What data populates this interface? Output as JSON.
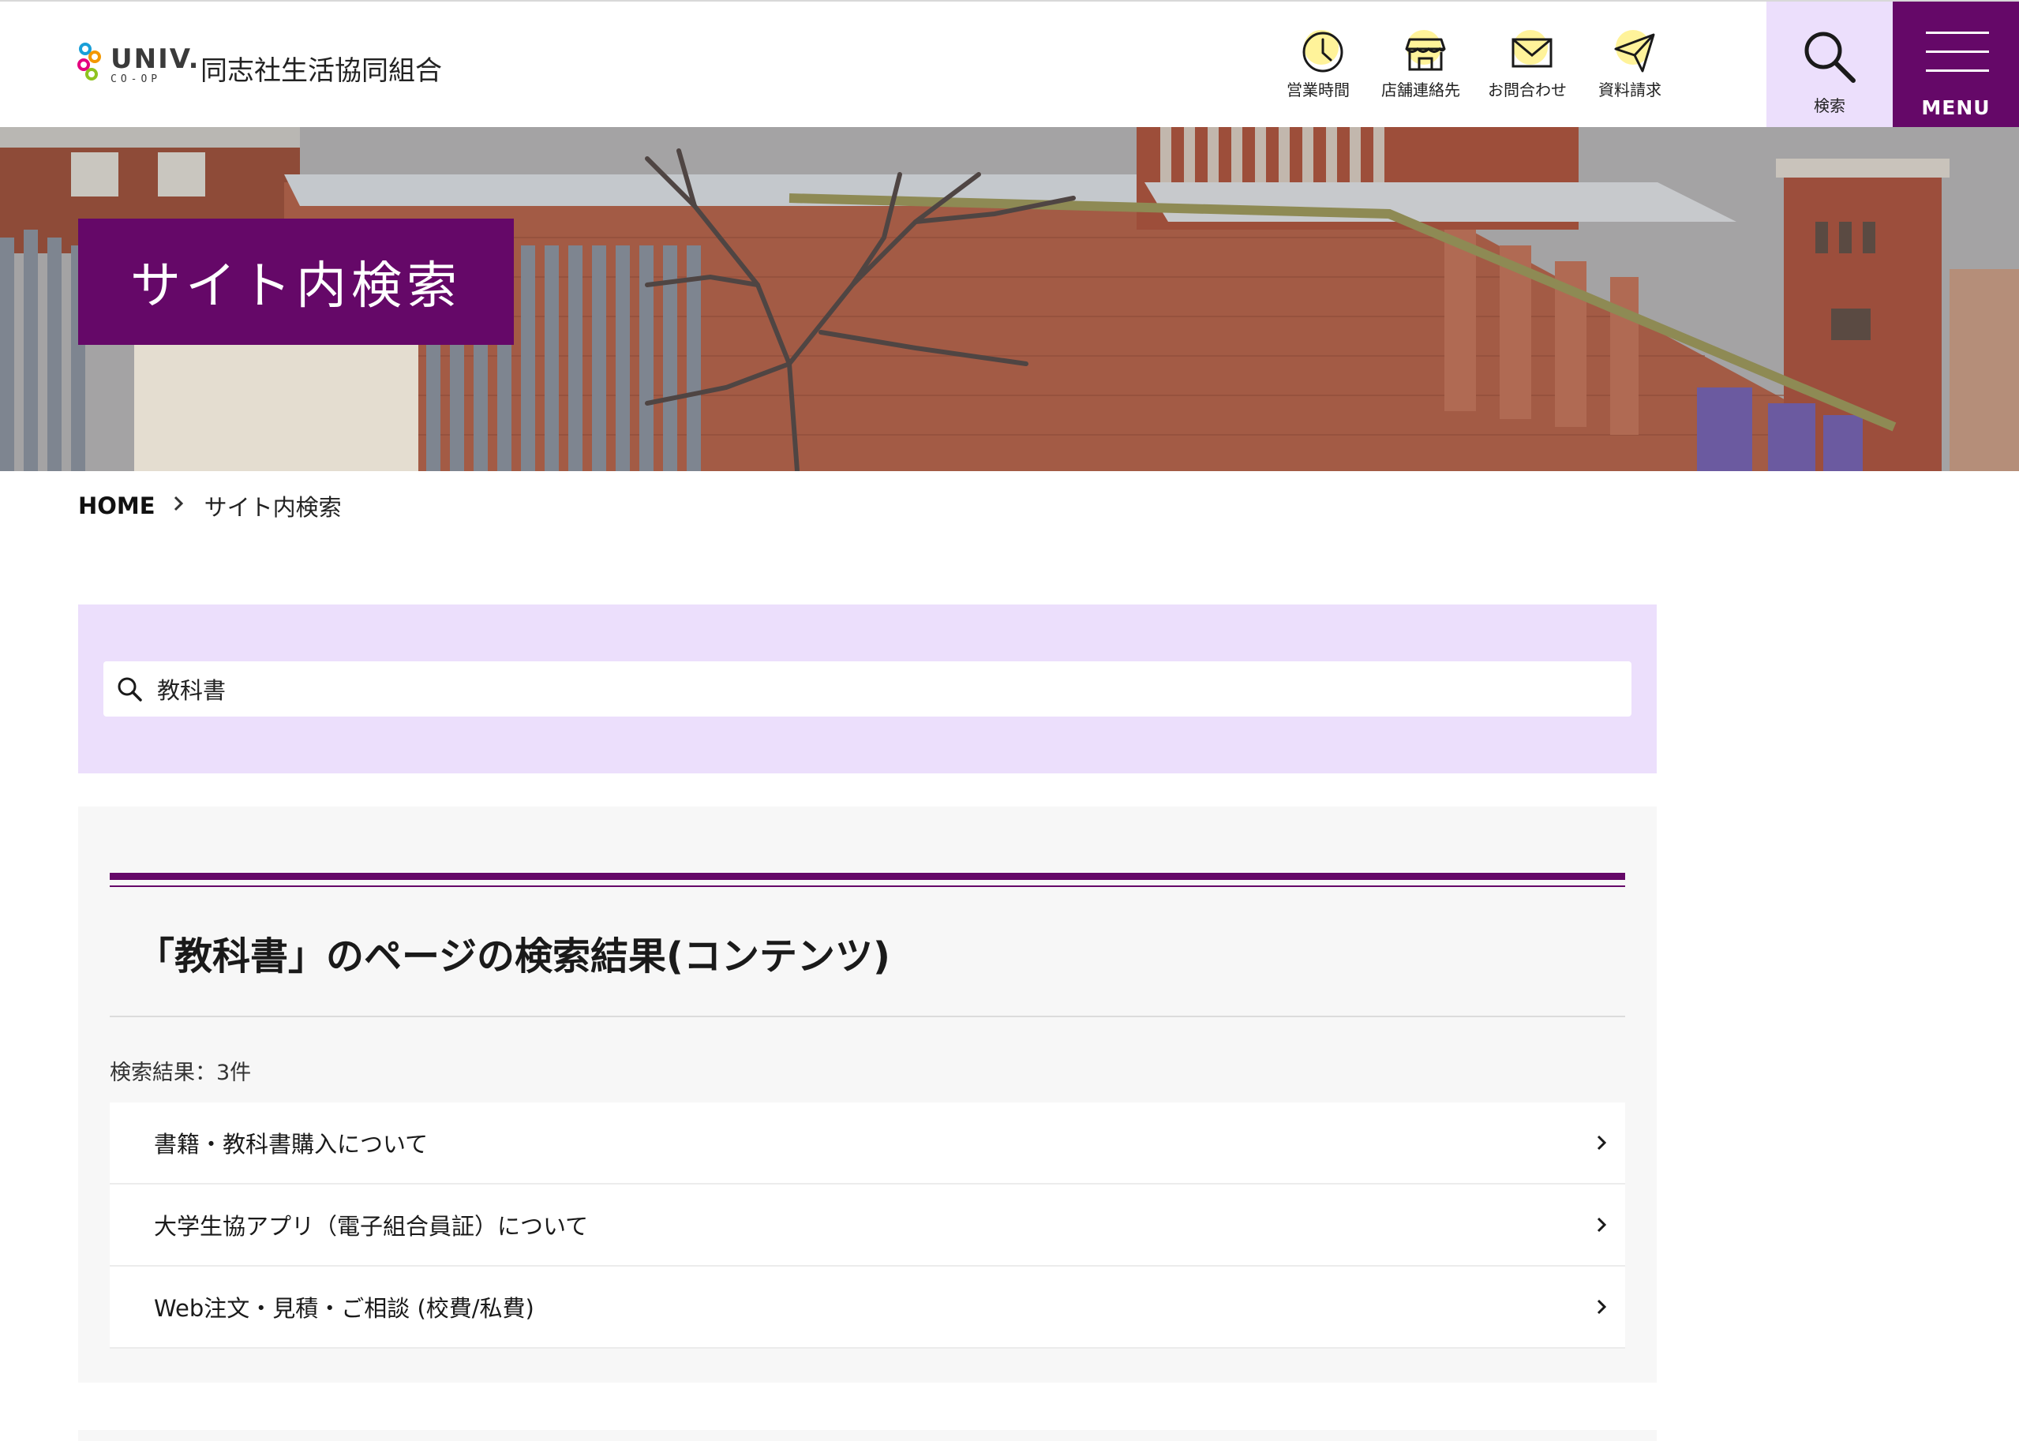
{
  "header": {
    "logo_univ": "UNIV.",
    "logo_coop": "CO-OP",
    "org_name": "同志社生活協同組合",
    "links": [
      {
        "label": "営業時間",
        "icon": "clock-icon"
      },
      {
        "label": "店舗連絡先",
        "icon": "store-icon"
      },
      {
        "label": "お問合わせ",
        "icon": "mail-icon"
      },
      {
        "label": "資料請求",
        "icon": "paper-plane-icon"
      }
    ],
    "search_label": "検索",
    "menu_label": "MENU"
  },
  "hero": {
    "title": "サイト内検索"
  },
  "breadcrumb": {
    "home": "HOME",
    "current": "サイト内検索"
  },
  "search": {
    "value": "教科書"
  },
  "results": {
    "heading": "「教科書」のページの検索結果(コンテンツ)",
    "count": "検索結果：3件",
    "items": [
      {
        "title": "書籍・教科書購入について"
      },
      {
        "title": "大学生協アプリ（電子組合員証）について"
      },
      {
        "title": "Web注文・見積・ご相談 (校費/私費)"
      }
    ]
  },
  "colors": {
    "brand_purple": "#650868",
    "light_lavender": "#ecdffc",
    "icon_highlight_yellow": "#fff39a"
  }
}
